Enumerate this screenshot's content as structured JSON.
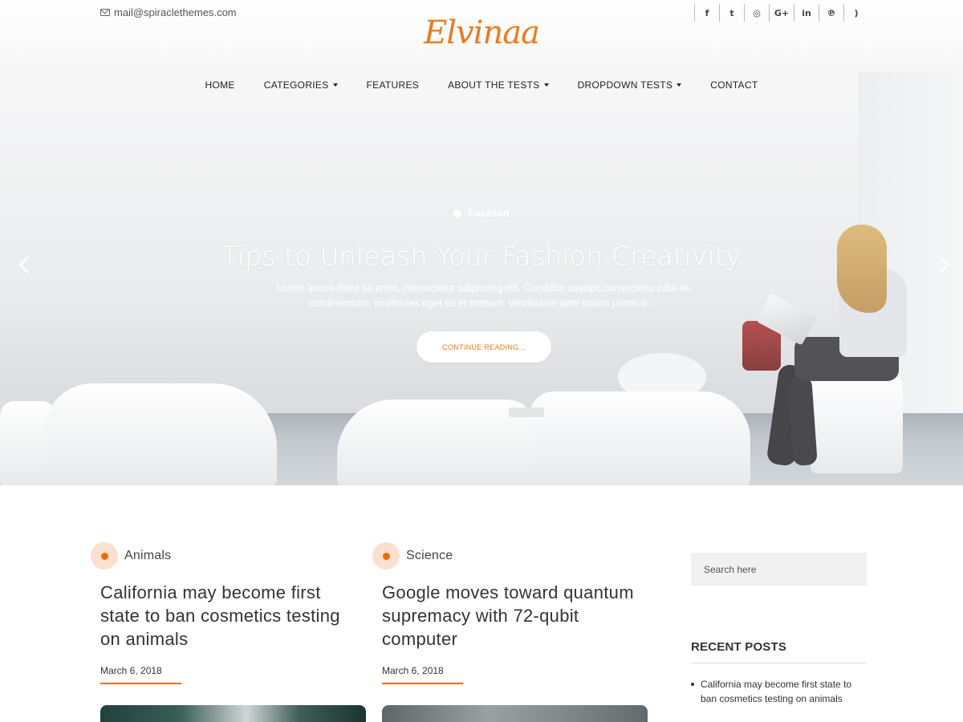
{
  "topbar": {
    "email": "mail@spiraclethemes.com",
    "social": [
      {
        "icon": "facebook-icon",
        "glyph": "f"
      },
      {
        "icon": "twitter-icon",
        "glyph": "t"
      },
      {
        "icon": "instagram-icon",
        "glyph": "◎"
      },
      {
        "icon": "google-plus-icon",
        "glyph": "G+"
      },
      {
        "icon": "linkedin-icon",
        "glyph": "in"
      },
      {
        "icon": "pinterest-icon",
        "glyph": "℗"
      },
      {
        "icon": "rss-icon",
        "glyph": ")"
      }
    ]
  },
  "logo": "Elvinaa",
  "nav": {
    "items": [
      {
        "label": "HOME",
        "dropdown": false
      },
      {
        "label": "CATEGORIES",
        "dropdown": true
      },
      {
        "label": "FEATURES",
        "dropdown": false
      },
      {
        "label": "ABOUT THE TESTS",
        "dropdown": true
      },
      {
        "label": "DROPDOWN TESTS",
        "dropdown": true
      },
      {
        "label": "CONTACT",
        "dropdown": false
      }
    ]
  },
  "slider": {
    "category": "Fashion",
    "title": "Tips to Unleash Your Fashion Creativity",
    "excerpt": "Lorem ipsum dolor sit amet, consectetur adipiscing elit. Curabitur suscipit consectetur nibh eu condimentum. In ultricies eget ex et pretium. Vestibulum ante ipsum primis in…",
    "button": "CONTINUE READING..."
  },
  "posts": [
    {
      "category": "Animals",
      "title": "California may become first state to ban cosmetics testing on animals",
      "date": "March 6, 2018"
    },
    {
      "category": "Science",
      "title": "Google moves toward quantum supremacy with 72-qubit computer",
      "date": "March 6, 2018"
    }
  ],
  "sidebar": {
    "search_placeholder": "Search here",
    "recent_title": "RECENT POSTS",
    "recent_posts": [
      "California may become first state to ban cosmetics testing on animals"
    ]
  },
  "colors": {
    "accent": "#ee7a1e",
    "category_dot": "#ee6b0d",
    "category_dot_bg": "#fbe0cf"
  }
}
